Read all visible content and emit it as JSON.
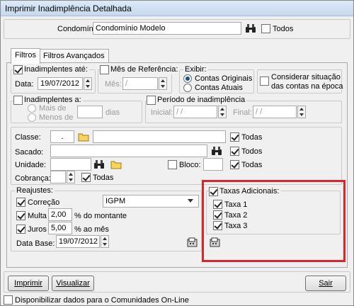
{
  "window": {
    "title": "Imprimir Inadimplência Detalhada"
  },
  "condominio": {
    "label": "Condomínio:",
    "value": "Condomínio Modelo",
    "todos_label": "Todos"
  },
  "tabs": [
    {
      "label": "Filtros"
    },
    {
      "label": "Filtros Avançados"
    }
  ],
  "inadimplentes_ate": {
    "label": "Inadimplentes até:",
    "data_label": "Data:",
    "date": "19/07/2012"
  },
  "mes_referencia": {
    "label": "Mês de Referência:",
    "mes_label": "Mês:",
    "value": " /"
  },
  "exibir": {
    "label": "Exibir:",
    "option1": "Contas Originais",
    "option2": "Contas Atuais"
  },
  "situacao": {
    "label_line1": "Considerar situação",
    "label_line2": "das contas na época"
  },
  "inadimplentes_a": {
    "label": "Inadimplentes a:",
    "mais_de": "Mais de",
    "menos_de": "Menos de",
    "dias": "dias"
  },
  "periodo": {
    "label": "Período de inadimplência",
    "inicial_label": "Inicial:",
    "inicial_value": " / /",
    "final_label": "Final:",
    "final_value": " / /"
  },
  "classe": {
    "label": "Classe:",
    "value": ".",
    "todas": "Todas"
  },
  "sacado": {
    "label": "Sacado:",
    "todos": "Todos"
  },
  "unidade": {
    "label": "Unidade:",
    "bloco_label": "Bloco:",
    "todas": "Todas"
  },
  "cobranca": {
    "label": "Cobrança:",
    "todas": "Todas"
  },
  "reajustes": {
    "label": "Reajustes:",
    "correcao_label": "Correção",
    "correcao_value": "IGPM",
    "multa_label": "Multa",
    "multa_value": "2,00",
    "multa_suffix": "% do montante",
    "juros_label": "Juros",
    "juros_value": "5,00",
    "juros_suffix": "% ao mês",
    "data_base_label": "Data Base:",
    "data_base_value": "19/07/2012"
  },
  "taxas": {
    "label": "Taxas Adicionais:",
    "items": [
      "Taxa 1",
      "Taxa 2",
      "Taxa 3"
    ]
  },
  "buttons": {
    "imprimir": "Imprimir",
    "visualizar": "Visualizar",
    "sair": "Sair"
  },
  "footer": {
    "label": "Disponibilizar dados para o Comunidades On-Line"
  },
  "colors": {
    "highlight": "#d9262c",
    "window_bg": "#f0f0f0"
  }
}
